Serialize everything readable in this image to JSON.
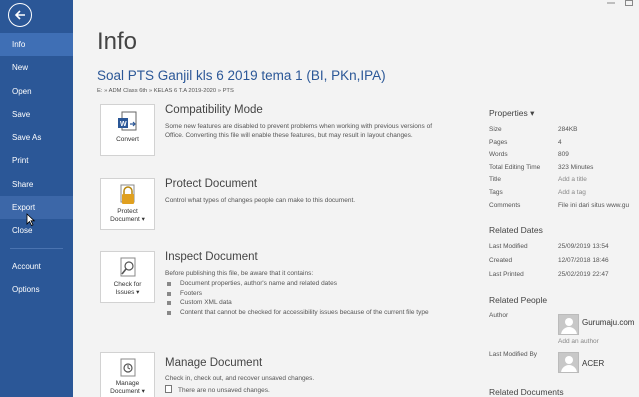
{
  "sidebar": {
    "items": [
      {
        "label": "Info"
      },
      {
        "label": "New"
      },
      {
        "label": "Open"
      },
      {
        "label": "Save"
      },
      {
        "label": "Save As"
      },
      {
        "label": "Print"
      },
      {
        "label": "Share"
      },
      {
        "label": "Export"
      },
      {
        "label": "Close"
      },
      {
        "label": "Account"
      },
      {
        "label": "Options"
      }
    ]
  },
  "main": {
    "title": "Info",
    "doc_title": "Soal PTS  Ganjil kls 6 2019 tema 1 (BI, PKn,IPA)",
    "doc_path": "E: » ADM Class 6th » KELAS 6 T.A 2019-2020 » PTS"
  },
  "sections": {
    "compat": {
      "title": "Compatibility Mode",
      "desc": "Some new features are disabled to prevent problems when working with previous versions of Office. Converting this file will enable these features, but may result in layout changes.",
      "button": "Convert"
    },
    "protect": {
      "title": "Protect Document",
      "desc": "Control what types of changes people can make to this document.",
      "button_line1": "Protect",
      "button_line2": "Document ▾"
    },
    "inspect": {
      "title": "Inspect Document",
      "desc": "Before publishing this file, be aware that it contains:",
      "button_line1": "Check for",
      "button_line2": "Issues ▾",
      "bullets": [
        "Document properties, author's name and related dates",
        "Footers",
        "Custom XML data",
        "Content that cannot be checked for accessibility issues because of the current file type"
      ]
    },
    "manage": {
      "title": "Manage Document",
      "desc": "Check in, check out, and recover unsaved changes.",
      "unsaved": "There are no unsaved changes.",
      "button_line1": "Manage",
      "button_line2": "Document ▾"
    }
  },
  "properties": {
    "header": "Properties ▾",
    "rows": [
      {
        "label": "Size",
        "value": "284KB"
      },
      {
        "label": "Pages",
        "value": "4"
      },
      {
        "label": "Words",
        "value": "809"
      },
      {
        "label": "Total Editing Time",
        "value": "323 Minutes"
      },
      {
        "label": "Title",
        "value": "Add a title"
      },
      {
        "label": "Tags",
        "value": "Add a tag"
      },
      {
        "label": "Comments",
        "value": "File ini dari situs www.gu"
      }
    ]
  },
  "related_dates": {
    "header": "Related Dates",
    "rows": [
      {
        "label": "Last Modified",
        "value": "25/09/2019 13:54"
      },
      {
        "label": "Created",
        "value": "12/07/2018 18:46"
      },
      {
        "label": "Last Printed",
        "value": "25/02/2019 22:47"
      }
    ]
  },
  "related_people": {
    "header": "Related People",
    "author_label": "Author",
    "author_name": "Gurumaju.com",
    "add_author": "Add an author",
    "last_modified_by_label": "Last Modified By",
    "last_modified_by_name": "ACER"
  },
  "related_documents": {
    "header": "Related Documents"
  },
  "colors": {
    "sidebar": "#2b5797",
    "accent": "#2b5797"
  }
}
